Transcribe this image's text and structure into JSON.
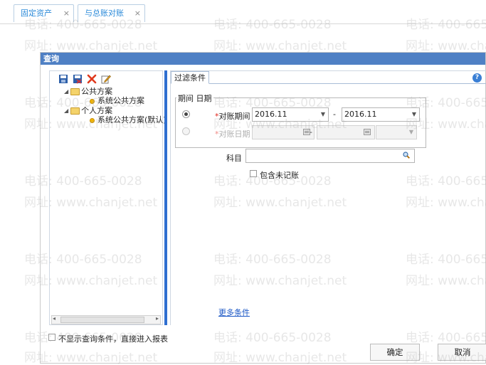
{
  "tabs": [
    {
      "label": "固定资产",
      "close": "×"
    },
    {
      "label": "与总账对账",
      "close": "×"
    }
  ],
  "dialog": {
    "title": "查询",
    "left_panel": {
      "toolbar_icons": [
        "save-icon",
        "save-as-icon",
        "delete-icon",
        "edit-icon"
      ],
      "tree": [
        {
          "label": "公共方案",
          "type": "folder",
          "expanded": true
        },
        {
          "label": "系统公共方案",
          "type": "scheme"
        },
        {
          "label": "个人方案",
          "type": "folder",
          "expanded": true
        },
        {
          "label": "系统公共方案(默认)",
          "type": "scheme"
        }
      ]
    },
    "right_panel": {
      "tab_label": "过滤条件",
      "help_label": "?",
      "group_label": "期间 日期",
      "period_row": {
        "required_mark": "*",
        "label": "对账期间",
        "from": "2016.11",
        "dash": "-",
        "to": "2016.11"
      },
      "date_row": {
        "required_mark": "*",
        "label": "对账日期",
        "from": "",
        "dash": "-",
        "to": ""
      },
      "subject_label": "科目",
      "subject_value": "",
      "include_unposted_label": "包含未记账",
      "more_conditions": "更多条件"
    },
    "footer": {
      "skip_checkbox_label": "不显示查询条件，直接进入报表",
      "ok_label": "确定",
      "cancel_label": "取消"
    }
  },
  "watermark": {
    "phone": "电话: 400-665-0028",
    "site": "网址: www.chanjet.net"
  },
  "colors": {
    "title_bar": "#4f80c4",
    "splitter": "#2f6fd0",
    "tab_text": "#2b8ad9",
    "required": "#e0241b",
    "link": "#1a56c5"
  }
}
